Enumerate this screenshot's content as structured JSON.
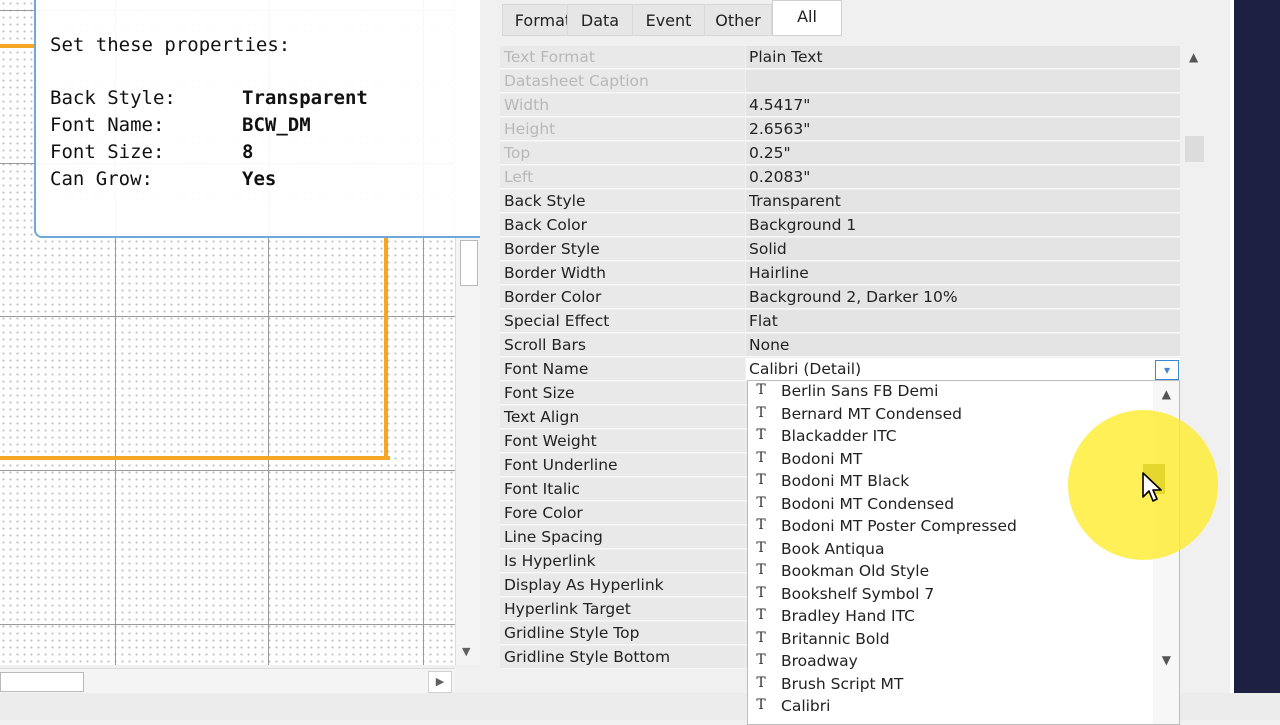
{
  "callout": {
    "title": "Set these properties:",
    "rows": [
      {
        "key": "Back Style:",
        "value": "Transparent"
      },
      {
        "key": "Font Name:",
        "value": "BCW_DM"
      },
      {
        "key": "Font Size:",
        "value": "8"
      },
      {
        "key": "Can Grow:",
        "value": "Yes"
      }
    ]
  },
  "tabs": [
    {
      "label": "Format"
    },
    {
      "label": "Data"
    },
    {
      "label": "Event"
    },
    {
      "label": "Other"
    },
    {
      "label": "All"
    }
  ],
  "active_tab": "All",
  "properties": [
    {
      "name": "Text Format",
      "value": "Plain Text"
    },
    {
      "name": "Datasheet Caption",
      "value": ""
    },
    {
      "name": "Width",
      "value": "4.5417\""
    },
    {
      "name": "Height",
      "value": "2.6563\""
    },
    {
      "name": "Top",
      "value": "0.25\""
    },
    {
      "name": "Left",
      "value": "0.2083\""
    },
    {
      "name": "Back Style",
      "value": "Transparent"
    },
    {
      "name": "Back Color",
      "value": "Background 1"
    },
    {
      "name": "Border Style",
      "value": "Solid"
    },
    {
      "name": "Border Width",
      "value": "Hairline"
    },
    {
      "name": "Border Color",
      "value": "Background 2, Darker 10%"
    },
    {
      "name": "Special Effect",
      "value": "Flat"
    },
    {
      "name": "Scroll Bars",
      "value": "None"
    },
    {
      "name": "Font Name",
      "value": "Calibri (Detail)"
    },
    {
      "name": "Font Size",
      "value": ""
    },
    {
      "name": "Text Align",
      "value": ""
    },
    {
      "name": "Font Weight",
      "value": ""
    },
    {
      "name": "Font Underline",
      "value": ""
    },
    {
      "name": "Font Italic",
      "value": ""
    },
    {
      "name": "Fore Color",
      "value": ""
    },
    {
      "name": "Line Spacing",
      "value": ""
    },
    {
      "name": "Is Hyperlink",
      "value": ""
    },
    {
      "name": "Display As Hyperlink",
      "value": ""
    },
    {
      "name": "Hyperlink Target",
      "value": ""
    },
    {
      "name": "Gridline Style Top",
      "value": ""
    },
    {
      "name": "Gridline Style Bottom",
      "value": ""
    }
  ],
  "font_options": [
    "Berlin Sans FB Demi",
    "Bernard MT Condensed",
    "Blackadder ITC",
    "Bodoni MT",
    "Bodoni MT Black",
    "Bodoni MT Condensed",
    "Bodoni MT Poster Compressed",
    "Book Antiqua",
    "Bookman Old Style",
    "Bookshelf Symbol 7",
    "Bradley Hand ITC",
    "Britannic Bold",
    "Broadway",
    "Brush Script MT",
    "Calibri"
  ],
  "font_type_icon": "T",
  "icons": {
    "scroll_up": "up-arrow-icon",
    "scroll_down": "down-arrow-icon",
    "scroll_right": "right-arrow-icon",
    "dropdown": "chevron-down-icon",
    "cursor": "mouse-pointer-icon"
  },
  "colors": {
    "highlight": "#ffe928",
    "accent": "#3b87d0",
    "control_outline": "#f5a623",
    "callout_border": "#6fa8d8"
  }
}
